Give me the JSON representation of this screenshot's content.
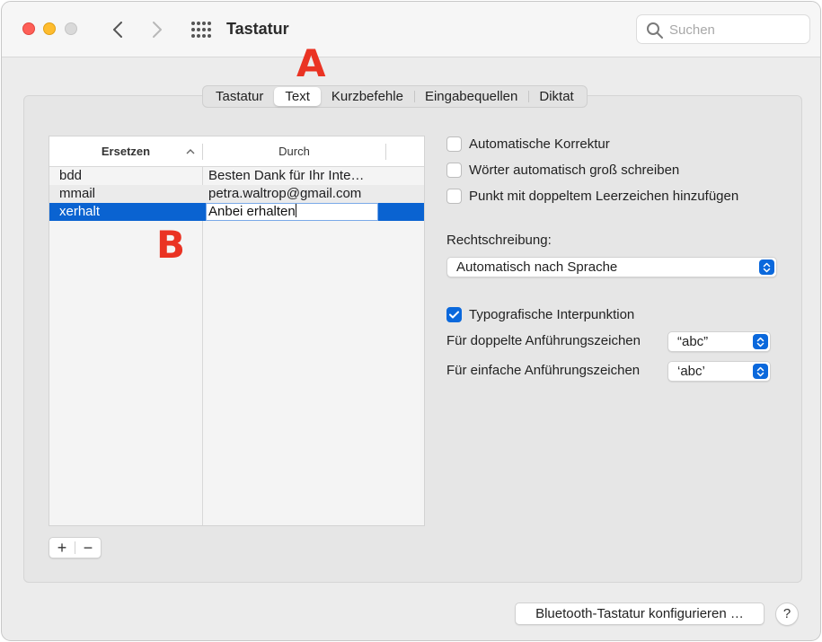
{
  "window": {
    "title": "Tastatur",
    "search_placeholder": "Suchen"
  },
  "annotations": {
    "a": "A",
    "b": "B"
  },
  "tabs": [
    {
      "label": "Tastatur",
      "active": false
    },
    {
      "label": "Text",
      "active": true
    },
    {
      "label": "Kurzbefehle",
      "active": false
    },
    {
      "label": "Eingabequellen",
      "active": false
    },
    {
      "label": "Diktat",
      "active": false
    }
  ],
  "table": {
    "columns": [
      "Ersetzen",
      "Durch"
    ],
    "rows": [
      {
        "replace": "bdd",
        "with": "Besten Dank für Ihr Inte…"
      },
      {
        "replace": "mmail",
        "with": "petra.waltrop@gmail.com"
      },
      {
        "replace": "xerhalt",
        "with": "Anbei erhalten",
        "selected": true,
        "editing": true
      }
    ],
    "add_label": "+",
    "remove_label": "−"
  },
  "options": {
    "auto_correct": {
      "label": "Automatische Korrektur",
      "checked": false
    },
    "auto_capitalize": {
      "label": "Wörter automatisch groß schreiben",
      "checked": false
    },
    "double_space_period": {
      "label": "Punkt mit doppeltem Leerzeichen hinzufügen",
      "checked": false
    },
    "spelling_label": "Rechtschreibung:",
    "spelling_value": "Automatisch nach Sprache",
    "smart_punctuation": {
      "label": "Typografische Interpunktion",
      "checked": true
    },
    "double_quotes_label": "Für doppelte Anführungszeichen",
    "double_quotes_value": "“abc”",
    "single_quotes_label": "Für einfache Anführungszeichen",
    "single_quotes_value": "‘abc’"
  },
  "footer": {
    "bluetooth_button": "Bluetooth-Tastatur konfigurieren …",
    "help_button": "?"
  },
  "colors": {
    "accent": "#0a68dc",
    "selection": "#0a63d1",
    "annotation": "#ea3323"
  },
  "icons": [
    "back-chevron-icon",
    "forward-chevron-icon",
    "grid-icon",
    "search-icon",
    "sort-up-icon",
    "stepper-icon",
    "checkmark-icon"
  ]
}
